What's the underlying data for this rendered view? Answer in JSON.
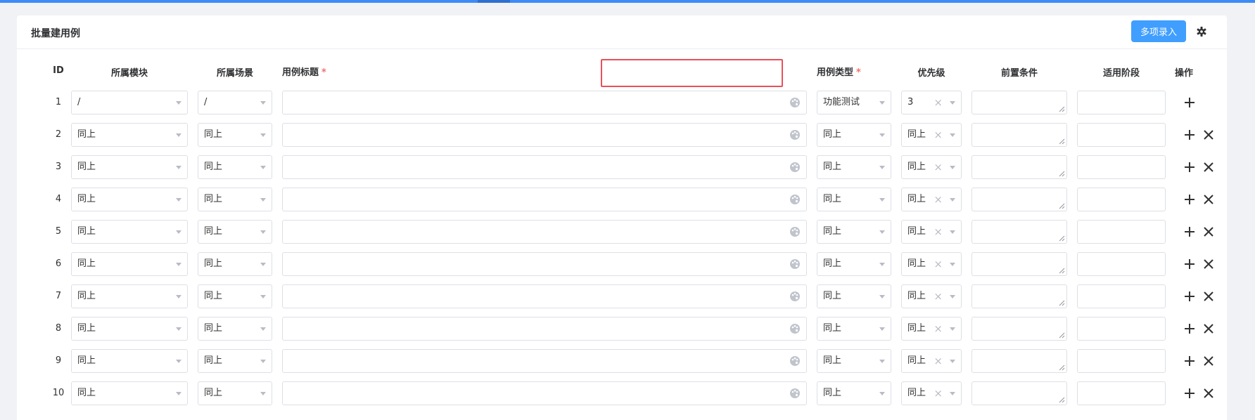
{
  "panel": {
    "title": "批量建用例",
    "multi_entry_label": "多项录入"
  },
  "columns": {
    "id": "ID",
    "module": "所属模块",
    "scene": "所属场景",
    "title": "用例标题",
    "type": "用例类型",
    "priority": "优先级",
    "precondition": "前置条件",
    "stage": "适用阶段",
    "actions": "操作"
  },
  "required_mark": "*",
  "rows": [
    {
      "id": "1",
      "module": "/",
      "scene": "/",
      "type": "功能测试",
      "priority": "3"
    },
    {
      "id": "2",
      "module": "同上",
      "scene": "同上",
      "type": "同上",
      "priority": "同上"
    },
    {
      "id": "3",
      "module": "同上",
      "scene": "同上",
      "type": "同上",
      "priority": "同上"
    },
    {
      "id": "4",
      "module": "同上",
      "scene": "同上",
      "type": "同上",
      "priority": "同上"
    },
    {
      "id": "5",
      "module": "同上",
      "scene": "同上",
      "type": "同上",
      "priority": "同上"
    },
    {
      "id": "6",
      "module": "同上",
      "scene": "同上",
      "type": "同上",
      "priority": "同上"
    },
    {
      "id": "7",
      "module": "同上",
      "scene": "同上",
      "type": "同上",
      "priority": "同上"
    },
    {
      "id": "8",
      "module": "同上",
      "scene": "同上",
      "type": "同上",
      "priority": "同上"
    },
    {
      "id": "9",
      "module": "同上",
      "scene": "同上",
      "type": "同上",
      "priority": "同上"
    },
    {
      "id": "10",
      "module": "同上",
      "scene": "同上",
      "type": "同上",
      "priority": "同上"
    }
  ],
  "icons": {
    "settings": "gear-icon",
    "title_color": "palette-icon",
    "add_row": "plus-icon",
    "delete_row": "close-icon"
  },
  "colors": {
    "primary": "#409eff",
    "required": "#f56c6c",
    "highlight": "#e8505b",
    "top_bar": "#3d8bf5"
  }
}
